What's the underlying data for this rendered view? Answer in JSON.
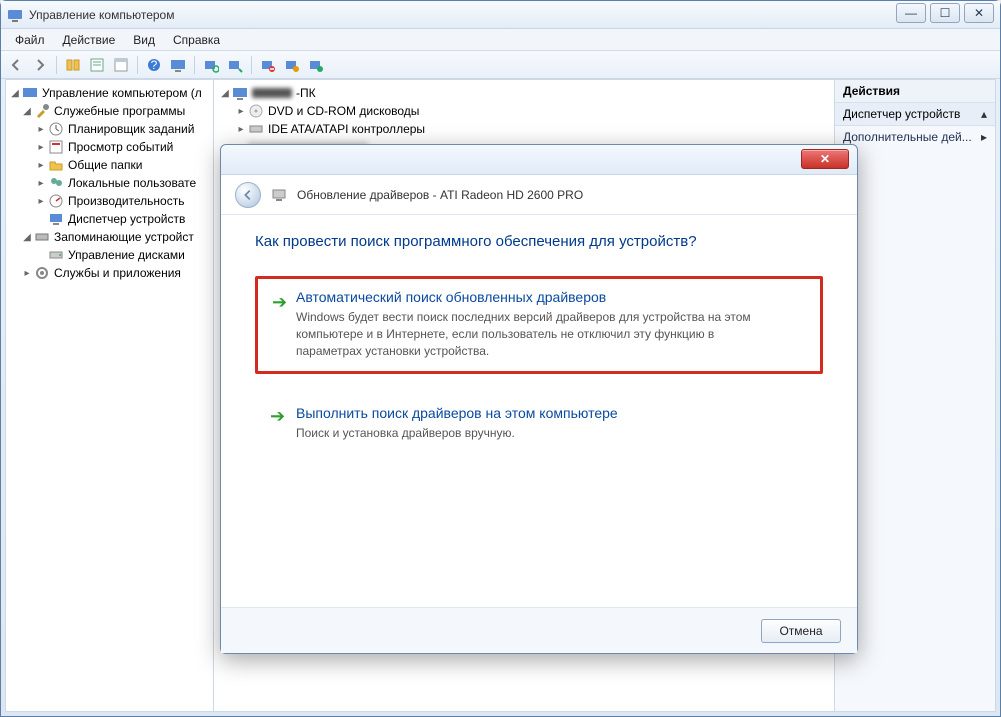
{
  "window": {
    "title": "Управление компьютером",
    "menu": {
      "file": "Файл",
      "action": "Действие",
      "view": "Вид",
      "help": "Справка"
    },
    "winbtns": {
      "min": "—",
      "max": "☐",
      "close": "✕"
    }
  },
  "toolbar": {
    "back": "back-icon",
    "fwd": "forward-icon",
    "icons": [
      "folder-icon",
      "list-icon",
      "grid-icon",
      "help-icon",
      "monitor-icon",
      "refresh-icon",
      "device-scan-icon",
      "enable-icon",
      "disable-icon",
      "update-icon"
    ]
  },
  "tree": {
    "root": "Управление компьютером (л",
    "group_system": "Служебные программы",
    "items_system": [
      "Планировщик заданий",
      "Просмотр событий",
      "Общие папки",
      "Локальные пользовате",
      "Производительность",
      "Диспетчер устройств"
    ],
    "group_storage": "Запоминающие устройст",
    "items_storage": [
      "Управление дисками"
    ],
    "group_services": "Службы и приложения"
  },
  "devices": {
    "root": "-ПК",
    "items": [
      "DVD и CD-ROM дисководы",
      "IDE ATA/ATAPI контроллеры"
    ]
  },
  "actions": {
    "header": "Действия",
    "section": "Диспетчер устройств",
    "more": "Дополнительные дей..."
  },
  "modal": {
    "title": "Обновление драйверов - ATI Radeon HD 2600 PRO",
    "question": "Как провести поиск программного обеспечения для устройств?",
    "opt1_title": "Автоматический поиск обновленных драйверов",
    "opt1_desc": "Windows будет вести поиск последних версий драйверов для устройства на этом компьютере и в Интернете, если пользователь не отключил эту функцию в параметрах установки устройства.",
    "opt2_title": "Выполнить поиск драйверов на этом компьютере",
    "opt2_desc": "Поиск и установка драйверов вручную.",
    "cancel": "Отмена",
    "close_glyph": "✕"
  }
}
